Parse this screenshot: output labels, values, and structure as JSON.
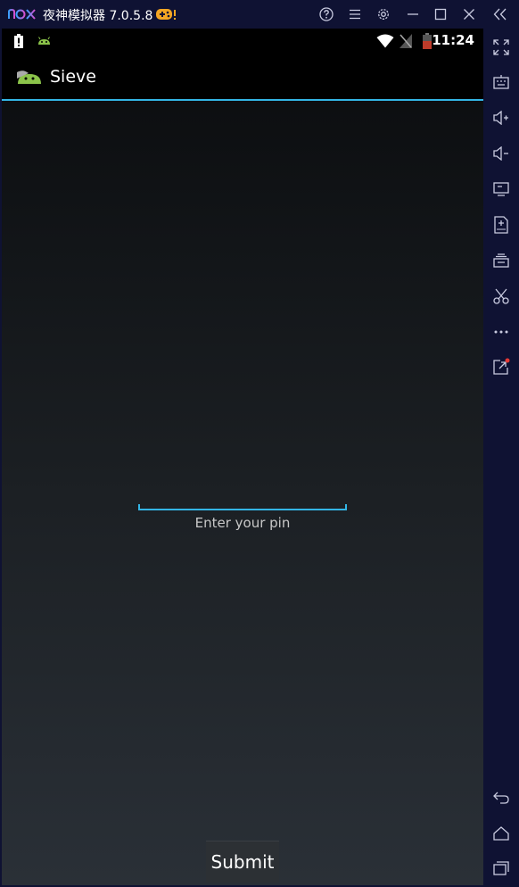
{
  "window": {
    "title": "夜神模拟器 7.0.5.8",
    "titlebar_buttons": [
      "help-icon",
      "menu-icon",
      "settings-icon",
      "minimize-icon",
      "maximize-icon",
      "close-icon",
      "collapse-sidebar-icon"
    ]
  },
  "statusbar": {
    "time": "11:24",
    "icons": [
      "battery-alert-icon",
      "sieve-notification-icon",
      "wifi-icon",
      "no-signal-icon",
      "battery-icon"
    ]
  },
  "app": {
    "title": "Sieve"
  },
  "form": {
    "pin_hint": "Enter your pin",
    "submit_label": "Submit"
  },
  "sidebar": {
    "icons": [
      "fullscreen-icon",
      "keyboard-icon",
      "volume-up-icon",
      "volume-down-icon",
      "screen-icon",
      "add-apk-icon",
      "multi-instance-icon",
      "scissors-icon",
      "more-icon",
      "share-icon",
      "back-icon",
      "home-icon",
      "recent-apps-icon"
    ]
  },
  "colors": {
    "accent": "#33b5e5",
    "frame": "#0f1233",
    "notification_dot": "#e53935"
  }
}
